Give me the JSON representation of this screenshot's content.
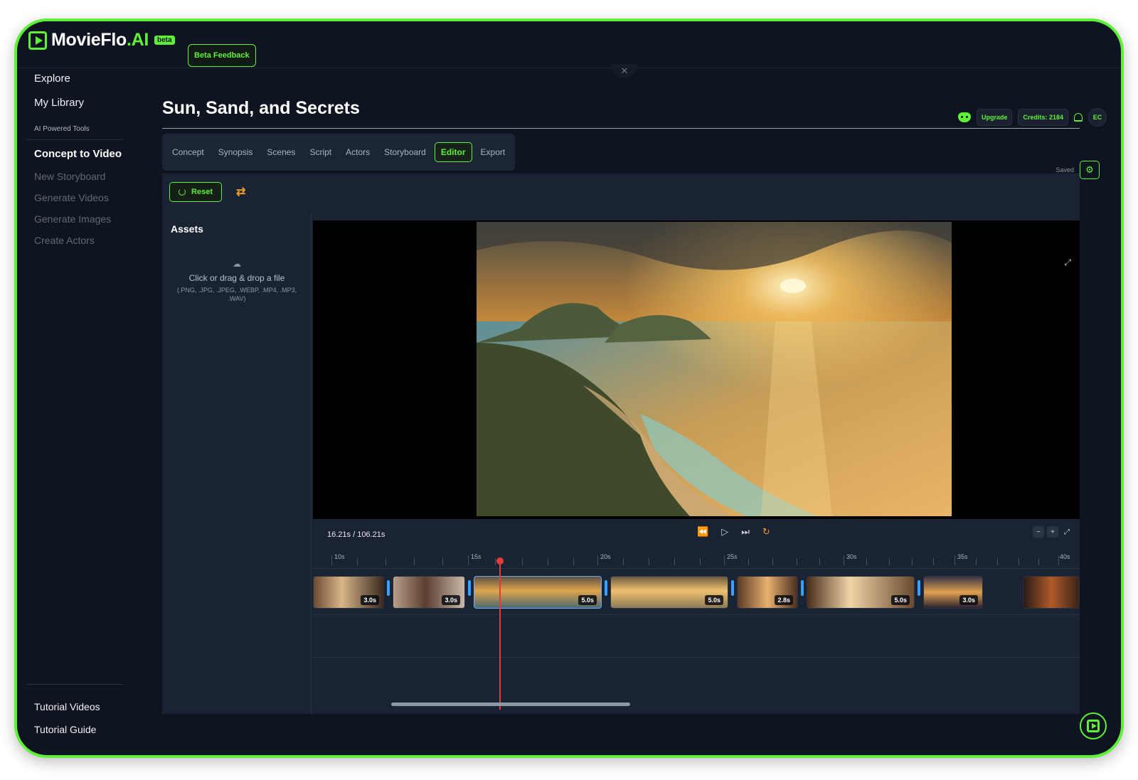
{
  "app": {
    "logo_main": "MovieFlo",
    "logo_accent": ".AI",
    "badge": "beta",
    "feedback_label": "Beta Feedback"
  },
  "sidebar": {
    "items": [
      {
        "label": "Explore"
      },
      {
        "label": "My Library"
      }
    ],
    "section_label": "AI Powered Tools",
    "tools": [
      {
        "label": "Concept to Video",
        "active": true
      },
      {
        "label": "New Storyboard"
      },
      {
        "label": "Generate Videos"
      },
      {
        "label": "Generate Images"
      },
      {
        "label": "Create Actors"
      }
    ],
    "footer": [
      {
        "label": "Tutorial Videos"
      },
      {
        "label": "Tutorial Guide"
      }
    ]
  },
  "header": {
    "title": "Sun, Sand, and Secrets",
    "upgrade_label": "Upgrade",
    "credits_label": "Credits: 2184",
    "avatar_initials": "EC",
    "discord_icon": "discord-icon",
    "bell_icon": "bell-icon"
  },
  "tabs": [
    {
      "label": "Concept"
    },
    {
      "label": "Synopsis"
    },
    {
      "label": "Scenes"
    },
    {
      "label": "Script"
    },
    {
      "label": "Actors"
    },
    {
      "label": "Storyboard"
    },
    {
      "label": "Editor",
      "active": true
    },
    {
      "label": "Export"
    }
  ],
  "status": {
    "saved_label": "Saved"
  },
  "toolbar": {
    "reset_label": "Reset"
  },
  "assets": {
    "title": "Assets",
    "upload_text": "Click or drag & drop a file",
    "upload_types": "(.PNG, .JPG, .JPEG, .WEBP, .MP4, .MP3, .WAV)"
  },
  "player": {
    "timecode": "16.21s / 106.21s"
  },
  "timeline": {
    "ruler_labels": [
      "10s",
      "15s",
      "20s",
      "25s",
      "30s",
      "35s",
      "40s"
    ],
    "clips": [
      {
        "duration": "3.0s",
        "theme": "woman-room"
      },
      {
        "duration": "3.0s",
        "theme": "woman-portrait"
      },
      {
        "duration": "5.0s",
        "theme": "sunset-island",
        "selected": true
      },
      {
        "duration": "5.0s",
        "theme": "beach-sunset"
      },
      {
        "duration": "2.8s",
        "theme": "beach-party"
      },
      {
        "duration": "5.0s",
        "theme": "crowd-party"
      },
      {
        "duration": "3.0s",
        "theme": "beach-dusk"
      },
      {
        "duration": "",
        "theme": "night-lights"
      }
    ]
  },
  "colors": {
    "accent": "#5ff03a",
    "background": "#0f1520",
    "panel": "#1a2333",
    "playhead": "#e63a3a",
    "clip_handle": "#3aa0ff"
  }
}
